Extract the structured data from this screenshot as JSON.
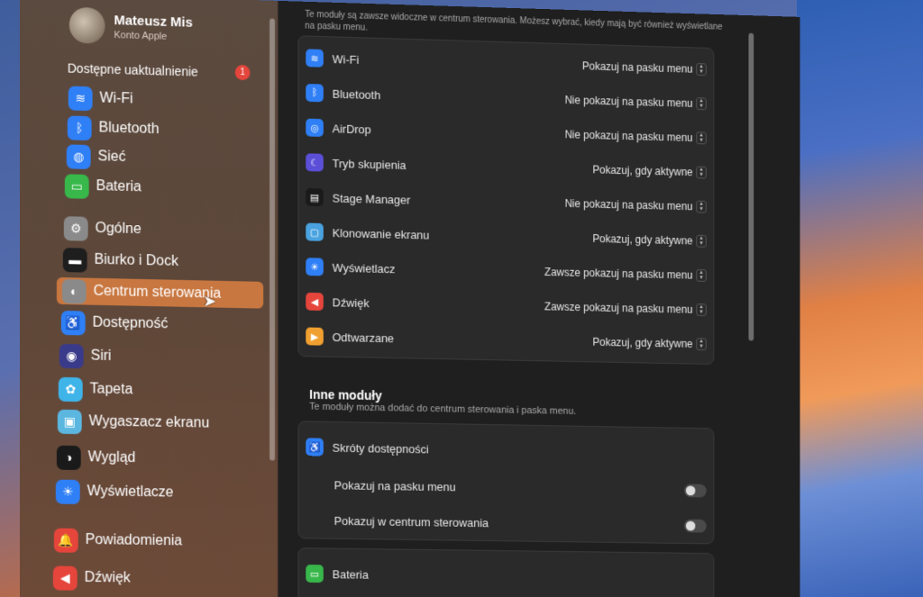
{
  "user": {
    "name": "Mateusz Mis",
    "subtitle": "Konto Apple"
  },
  "updates": {
    "label": "Dostępne uaktualnienie",
    "count": "1"
  },
  "sidebar": {
    "items": [
      {
        "label": "Wi-Fi",
        "icon": "wifi-icon",
        "color": "#2f7ff6"
      },
      {
        "label": "Bluetooth",
        "icon": "bluetooth-icon",
        "color": "#2f7ff6"
      },
      {
        "label": "Sieć",
        "icon": "globe-icon",
        "color": "#2f7ff6"
      },
      {
        "label": "Bateria",
        "icon": "battery-icon",
        "color": "#38b74a"
      },
      {
        "label": "Ogólne",
        "icon": "gear-icon",
        "color": "#8a8a8a"
      },
      {
        "label": "Biurko i Dock",
        "icon": "dock-icon",
        "color": "#1e1e1e"
      },
      {
        "label": "Centrum sterowania",
        "icon": "control-center-icon",
        "color": "#8a8a8a"
      },
      {
        "label": "Dostępność",
        "icon": "accessibility-icon",
        "color": "#2f7ff6"
      },
      {
        "label": "Siri",
        "icon": "siri-icon",
        "color": "#3a3a8a"
      },
      {
        "label": "Tapeta",
        "icon": "wallpaper-icon",
        "color": "#3fb4e8"
      },
      {
        "label": "Wygaszacz ekranu",
        "icon": "screensaver-icon",
        "color": "#5bb7e0"
      },
      {
        "label": "Wygląd",
        "icon": "appearance-icon",
        "color": "#1a1a1a"
      },
      {
        "label": "Wyświetlacze",
        "icon": "display-icon",
        "color": "#2f7ff6"
      },
      {
        "label": "Powiadomienia",
        "icon": "bell-icon",
        "color": "#e5453b"
      },
      {
        "label": "Dźwięk",
        "icon": "speaker-icon",
        "color": "#e5453b"
      }
    ],
    "active_index": 6
  },
  "main": {
    "intro": "Te moduły są zawsze widoczne w centrum sterowania. Możesz wybrać, kiedy mają być również wyświetlane na pasku menu.",
    "modules": [
      {
        "label": "Wi-Fi",
        "value": "Pokazuj na pasku menu",
        "icon": "wifi-icon",
        "color": "#2f7ff6"
      },
      {
        "label": "Bluetooth",
        "value": "Nie pokazuj na pasku menu",
        "icon": "bluetooth-icon",
        "color": "#2f7ff6"
      },
      {
        "label": "AirDrop",
        "value": "Nie pokazuj na pasku menu",
        "icon": "airdrop-icon",
        "color": "#2f7ff6"
      },
      {
        "label": "Tryb skupienia",
        "value": "Pokazuj, gdy aktywne",
        "icon": "moon-icon",
        "color": "#5b4fd8"
      },
      {
        "label": "Stage Manager",
        "value": "Nie pokazuj na pasku menu",
        "icon": "stage-manager-icon",
        "color": "#1a1a1a"
      },
      {
        "label": "Klonowanie ekranu",
        "value": "Pokazuj, gdy aktywne",
        "icon": "screen-mirroring-icon",
        "color": "#4aa3e0"
      },
      {
        "label": "Wyświetlacz",
        "value": "Zawsze pokazuj na pasku menu",
        "icon": "sun-icon",
        "color": "#2f7ff6"
      },
      {
        "label": "Dźwięk",
        "value": "Zawsze pokazuj na pasku menu",
        "icon": "speaker-icon",
        "color": "#e5453b"
      },
      {
        "label": "Odtwarzane",
        "value": "Pokazuj, gdy aktywne",
        "icon": "play-icon",
        "color": "#f0a030"
      }
    ],
    "other_title": "Inne moduły",
    "other_subtitle": "Te moduły można dodać do centrum sterowania i paska menu.",
    "accessibility": {
      "label": "Skróty dostępności",
      "show_menu": "Pokazuj na pasku menu",
      "show_cc": "Pokazuj w centrum sterowania"
    },
    "battery": {
      "label": "Bateria"
    }
  }
}
